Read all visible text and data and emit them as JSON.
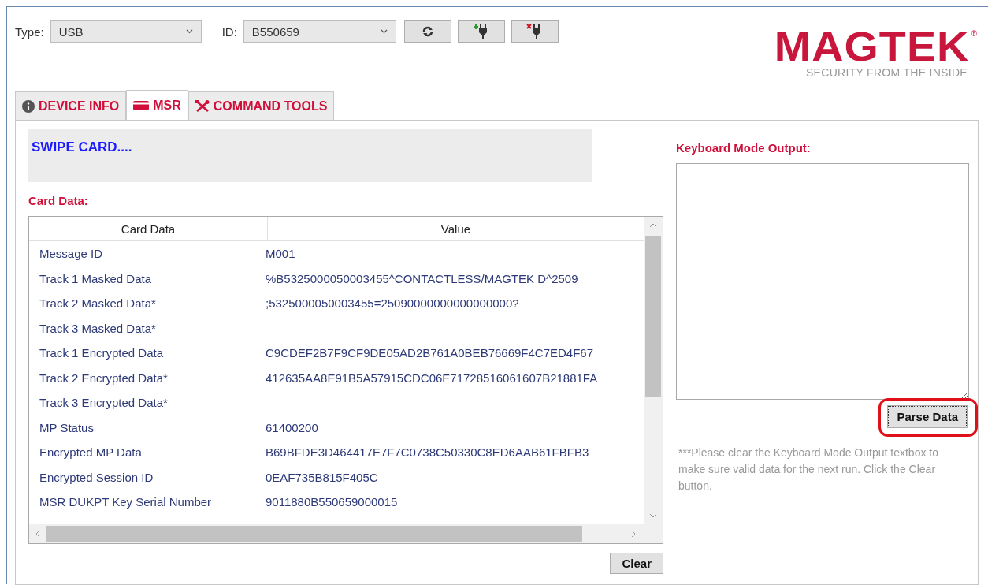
{
  "toolbar": {
    "type_label": "Type:",
    "type_value": "USB",
    "id_label": "ID:",
    "id_value": "B550659"
  },
  "logo": {
    "name": "MAGTEK",
    "mark": "®",
    "tagline": "SECURITY FROM THE INSIDE"
  },
  "tabs": [
    {
      "label": "DEVICE INFO",
      "kind": "info",
      "selected": false
    },
    {
      "label": "MSR",
      "kind": "card",
      "selected": true
    },
    {
      "label": "COMMAND TOOLS",
      "kind": "tools",
      "selected": false
    }
  ],
  "status": "SWIPE CARD....",
  "card_data": {
    "title": "Card Data:",
    "columns": [
      "Card Data",
      "Value"
    ],
    "rows": [
      {
        "name": "Message ID",
        "value": "M001"
      },
      {
        "name": "Track 1 Masked Data",
        "value": "%B5325000050003455^CONTACTLESS/MAGTEK D^2509"
      },
      {
        "name": "Track 2 Masked Data*",
        "value": ";5325000050003455=25090000000000000000?"
      },
      {
        "name": "Track 3 Masked Data*"
      },
      {
        "name": "Track 1 Encrypted Data",
        "value": "C9CDEF2B7F9CF9DE05AD2B761A0BEB76669F4C7ED4F67"
      },
      {
        "name": "Track 2 Encrypted Data*",
        "value": "412635AA8E91B5A57915CDC06E71728516061607B21881FA"
      },
      {
        "name": "Track 3 Encrypted Data*"
      },
      {
        "name": "MP Status",
        "value": "61400200"
      },
      {
        "name": "Encrypted MP Data",
        "value": "B69BFDE3D464417E7F7C0738C50330C8ED6AAB61FBFB3"
      },
      {
        "name": "Encrypted Session ID",
        "value": "0EAF735B815F405C"
      },
      {
        "name": "MSR DUKPT Key Serial Number",
        "value": "9011880B550659000015"
      }
    ]
  },
  "keyboard": {
    "title": "Keyboard Mode Output:"
  },
  "parse_button": "Parse Data",
  "note": "***Please clear the Keyboard Mode Output textbox to make sure valid data for the next run. Click the Clear button.",
  "clear_button": "Clear"
}
